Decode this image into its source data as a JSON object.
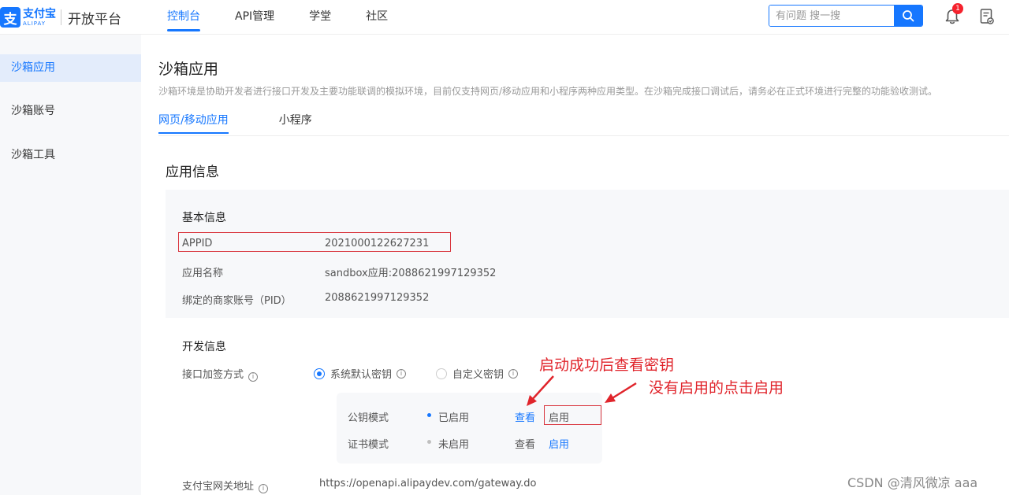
{
  "header": {
    "logo_mark": "支",
    "logo_cn": "支付宝",
    "logo_en": "ALIPAY",
    "platform": "开放平台",
    "nav": [
      "控制台",
      "API管理",
      "学堂",
      "社区"
    ],
    "search_placeholder": "有问题 搜一搜",
    "notification_count": "1"
  },
  "sidebar": {
    "items": [
      "沙箱应用",
      "沙箱账号",
      "沙箱工具"
    ]
  },
  "main": {
    "title": "沙箱应用",
    "description": "沙箱环境是协助开发者进行接口开发及主要功能联调的模拟环境，目前仅支持网页/移动应用和小程序两种应用类型。在沙箱完成接口调试后，请务必在正式环境进行完整的功能验收测试。",
    "tabs": [
      "网页/移动应用",
      "小程序"
    ],
    "section_title": "应用信息",
    "basic": {
      "title": "基本信息",
      "appid_label": "APPID",
      "appid_value": "2021000122627231",
      "app_name_label": "应用名称",
      "app_name_value": "sandbox应用:2088621997129352",
      "pid_label": "绑定的商家账号（PID）",
      "pid_value": "2088621997129352"
    },
    "dev": {
      "title": "开发信息",
      "sign_label": "接口加签方式",
      "option_default": "系统默认密钥",
      "option_custom": "自定义密钥",
      "modes": [
        {
          "name": "公钥模式",
          "status": "已启用",
          "view": "查看",
          "action": "启用"
        },
        {
          "name": "证书模式",
          "status": "未启用",
          "view": "查看",
          "action": "启用"
        }
      ],
      "gateway_label": "支付宝网关地址",
      "gateway_value": "https://openapi.alipaydev.com/gateway.do"
    }
  },
  "annotations": {
    "text1": "启动成功后查看密钥",
    "text2": "没有启用的点击启用"
  },
  "watermark": "CSDN @清风微凉 aaa",
  "colors": {
    "brand": "#1677ff",
    "annotation": "#e0242b",
    "enabled_dot": "#1677ff",
    "disabled_dot": "#bfbfbf"
  }
}
